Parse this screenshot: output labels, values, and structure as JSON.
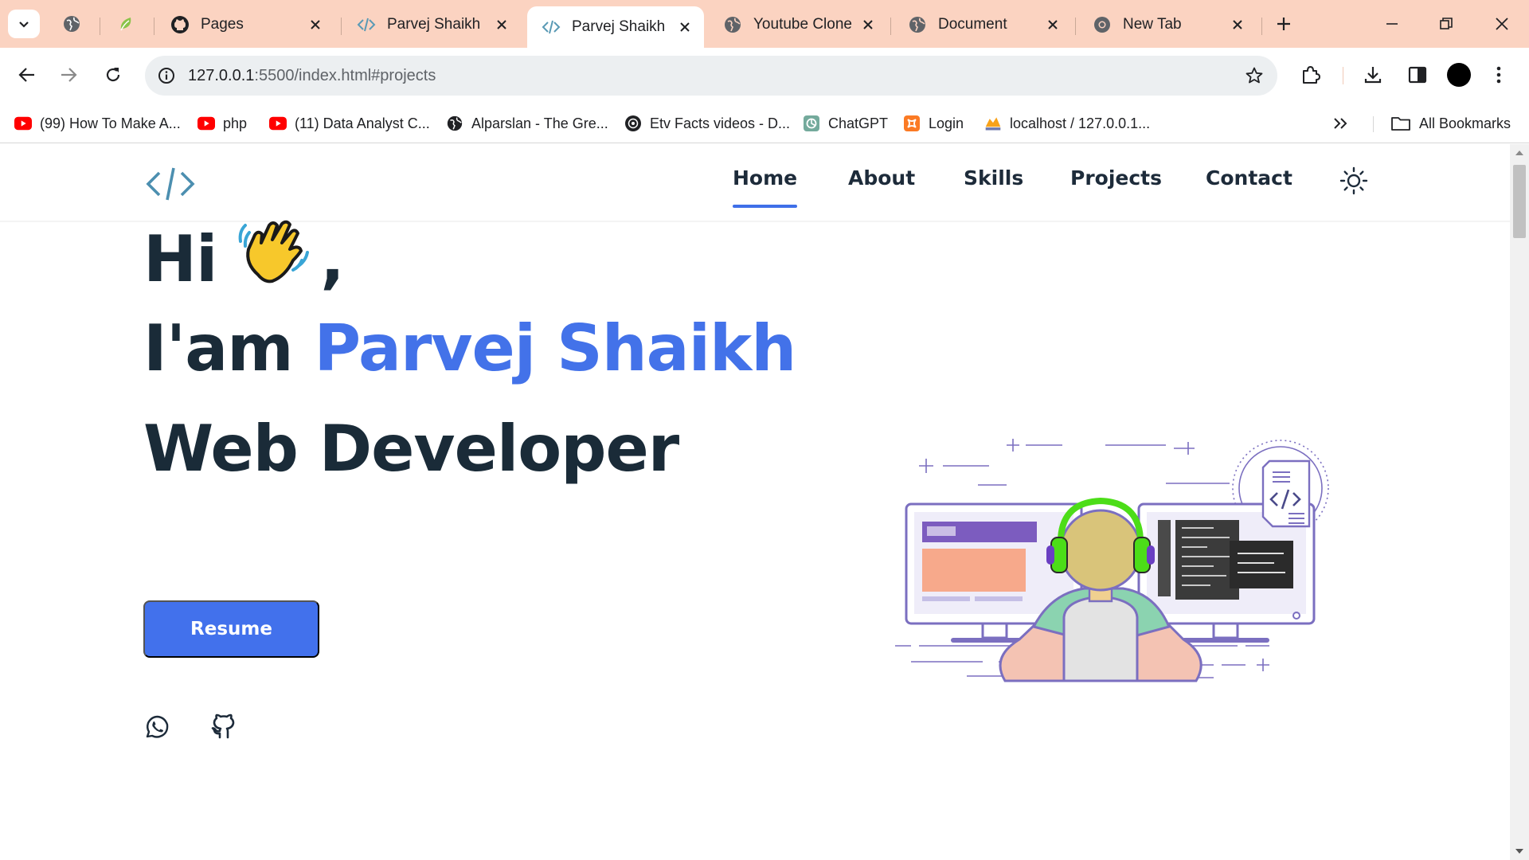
{
  "browser": {
    "tabs": [
      {
        "title": "Pages",
        "icon": "github-icon",
        "active": false
      },
      {
        "title": "Parvej Shaikh",
        "icon": "code-icon",
        "active": false
      },
      {
        "title": "Parvej Shaikh",
        "icon": "code-icon",
        "active": true
      },
      {
        "title": "Youtube Clone",
        "icon": "globe-icon",
        "active": false
      },
      {
        "title": "Document",
        "icon": "globe-icon",
        "active": false
      },
      {
        "title": "New Tab",
        "icon": "chrome-icon",
        "active": false
      }
    ],
    "url_host": "127.0.0.1",
    "url_path": ":5500/index.html#projects",
    "bookmarks": [
      {
        "label": "(99) How To Make A...",
        "icon": "youtube-icon"
      },
      {
        "label": "php",
        "icon": "youtube-icon"
      },
      {
        "label": "(11) Data Analyst C...",
        "icon": "youtube-icon"
      },
      {
        "label": "Alparslan - The Gre...",
        "icon": "globe-icon"
      },
      {
        "label": "Etv Facts videos - D...",
        "icon": "record-icon"
      },
      {
        "label": "ChatGPT",
        "icon": "chatgpt-icon"
      },
      {
        "label": "Login",
        "icon": "xampp-icon"
      },
      {
        "label": "localhost / 127.0.0.1...",
        "icon": "phpmyadmin-icon"
      }
    ],
    "all_bookmarks": "All Bookmarks"
  },
  "site": {
    "nav": [
      "Home",
      "About",
      "Skills",
      "Projects",
      "Contact"
    ],
    "active_nav": "Home",
    "hero": {
      "greeting": "Hi",
      "comma": ",",
      "intro": "I'am",
      "name": "Parvej Shaikh",
      "role": "Web Developer"
    },
    "resume_label": "Resume",
    "social": [
      "whatsapp-icon",
      "github-icon"
    ]
  },
  "colors": {
    "tabstrip": "#fbd3c1",
    "accent": "#4271ec",
    "heading": "#1a2b38"
  }
}
